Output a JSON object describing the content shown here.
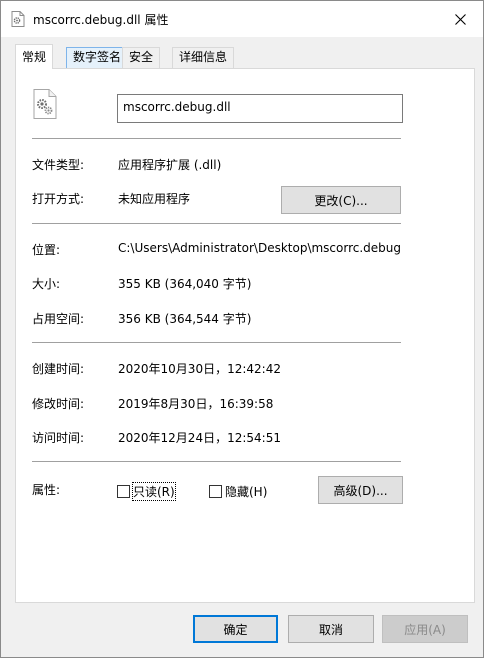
{
  "window": {
    "title": "mscorrc.debug.dll 属性",
    "close_label": "✕"
  },
  "tabs": [
    {
      "label": "常规",
      "active": true
    },
    {
      "label": "数字签名",
      "active": false
    },
    {
      "label": "安全",
      "active": false
    },
    {
      "label": "详细信息",
      "active": false
    }
  ],
  "general": {
    "file_name": "mscorrc.debug.dll",
    "file_icon": "dll-gear-file-icon",
    "type_label": "文件类型:",
    "type_value": "应用程序扩展 (.dll)",
    "opens_label": "打开方式:",
    "opens_value": "未知应用程序",
    "change_button": "更改(C)...",
    "location_label": "位置:",
    "location_value": "C:\\Users\\Administrator\\Desktop\\mscorrc.debug",
    "size_label": "大小:",
    "size_value": "355 KB (364,040 字节)",
    "disk_label": "占用空间:",
    "disk_value": "356 KB (364,544 字节)",
    "created_label": "创建时间:",
    "created_value": "2020年10月30日，12:42:42",
    "modified_label": "修改时间:",
    "modified_value": "2019年8月30日，16:39:58",
    "accessed_label": "访问时间:",
    "accessed_value": "2020年12月24日，12:54:51",
    "attributes_label": "属性:",
    "readonly_label": "只读(R)",
    "readonly_checked": false,
    "hidden_label": "隐藏(H)",
    "hidden_checked": false,
    "advanced_button": "高级(D)..."
  },
  "footer": {
    "ok": "确定",
    "cancel": "取消",
    "apply": "应用(A)"
  },
  "colors": {
    "focus_accent": "#0078d7",
    "tab_hover": "#e5f1fb"
  }
}
